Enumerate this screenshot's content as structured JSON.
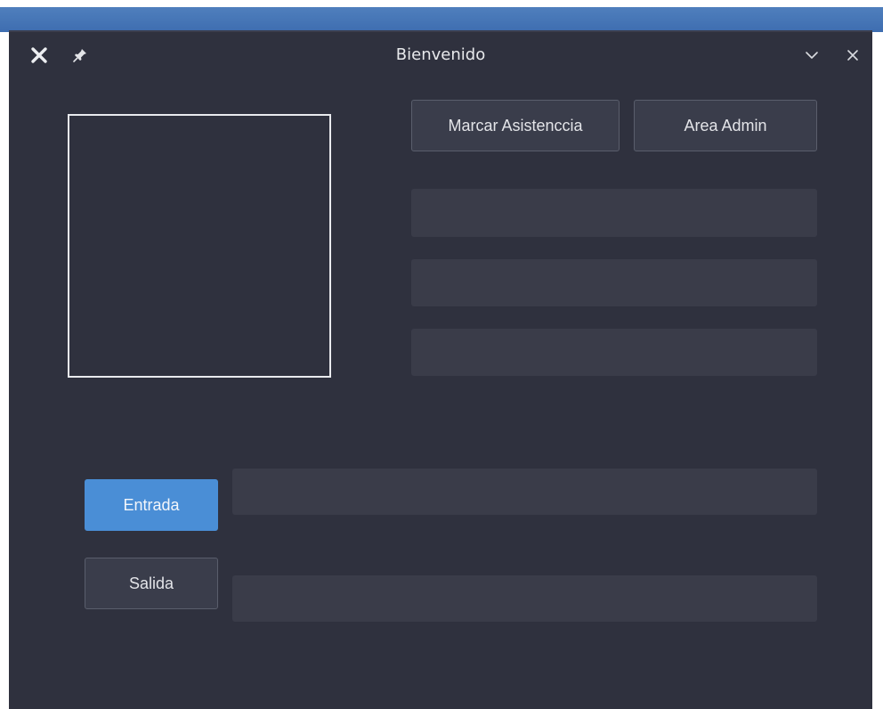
{
  "window": {
    "title": "Bienvenido"
  },
  "titlebar": {
    "app_icon": "x-app-icon",
    "pin_icon": "pin-icon",
    "minimize_icon": "chevron-down-icon",
    "close_icon": "close-icon"
  },
  "buttons": {
    "marcar_label": "Marcar Asistenccia",
    "admin_label": "Area Admin",
    "entrada_label": "Entrada",
    "salida_label": "Salida"
  },
  "fields": {
    "info1": {
      "value": "",
      "placeholder": ""
    },
    "info2": {
      "value": "",
      "placeholder": ""
    },
    "info3": {
      "value": "",
      "placeholder": ""
    },
    "entrada": {
      "value": "",
      "placeholder": ""
    },
    "salida": {
      "value": "",
      "placeholder": ""
    }
  },
  "colors": {
    "window_bg": "#2f313e",
    "field_bg": "#3a3c49",
    "primary": "#4a8ed6",
    "text": "#e3e4e8"
  }
}
